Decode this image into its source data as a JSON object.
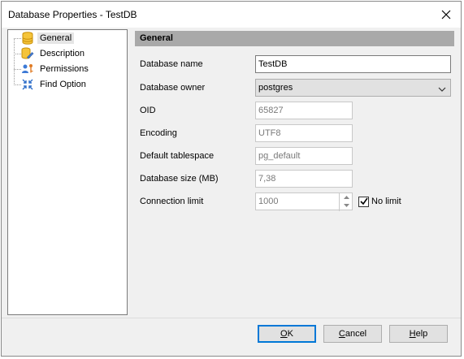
{
  "window": {
    "title": "Database Properties - TestDB"
  },
  "sidebar": {
    "items": [
      {
        "label": "General",
        "icon": "database-icon",
        "selected": true
      },
      {
        "label": "Description",
        "icon": "database-pencil-icon",
        "selected": false
      },
      {
        "label": "Permissions",
        "icon": "users-key-icon",
        "selected": false
      },
      {
        "label": "Find Option",
        "icon": "arrows-in-icon",
        "selected": false
      }
    ]
  },
  "panel": {
    "header": "General",
    "fields": {
      "database_name": {
        "label": "Database name",
        "value": "TestDB"
      },
      "database_owner": {
        "label": "Database owner",
        "value": "postgres"
      },
      "oid": {
        "label": "OID",
        "value": "65827"
      },
      "encoding": {
        "label": "Encoding",
        "value": "UTF8"
      },
      "tablespace": {
        "label": "Default tablespace",
        "value": "pg_default"
      },
      "size": {
        "label": "Database size (MB)",
        "value": "7,38"
      },
      "connection_limit": {
        "label": "Connection limit",
        "value": "1000"
      }
    },
    "no_limit": {
      "label": "No limit",
      "checked": true
    }
  },
  "footer": {
    "ok": {
      "mnemonic": "O",
      "rest": "K"
    },
    "cancel": {
      "mnemonic": "C",
      "rest": "ancel"
    },
    "help": {
      "mnemonic": "H",
      "rest": "elp"
    }
  },
  "colors": {
    "accent": "#0078d7",
    "header_bg": "#a9a9a9",
    "dialog_bg": "#f0f0f0"
  }
}
